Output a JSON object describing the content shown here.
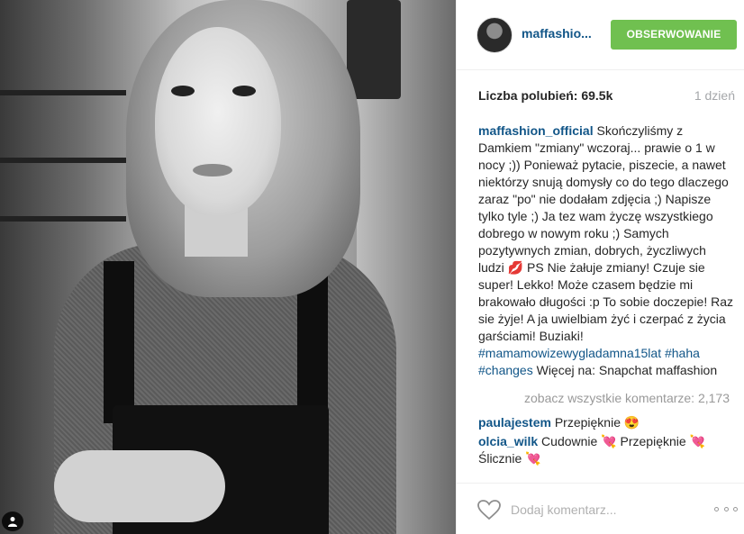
{
  "post": {
    "user_tag_icon": "person-icon"
  },
  "header": {
    "username": "maffashio...",
    "follow_label": "OBSERWOWANIE",
    "follow_color": "#70c050"
  },
  "stats": {
    "likes": "Liczba polubień: 69.5k",
    "age": "1 dzień"
  },
  "caption": {
    "author": "maffashion_official",
    "text_part1": " Skończyliśmy z Damkiem \"zmiany\" wczoraj... prawie o 1 w nocy ;)) Ponieważ pytacie, piszecie, a nawet niektórzy snują domysły co do tego dlaczego zaraz \"po\" nie dodałam zdjęcia ;) Napisze tylko tyle ;) Ja tez wam życzę wszystkiego dobrego w nowym roku ;) Samych pozytywnych zmian, dobrych, życzliwych ludzi 💋 PS Nie żałuje zmiany! Czuje sie super! Lekko! Może czasem będzie mi brakowało długości :p To sobie doczepie! Raz sie żyje! A ja uwielbiam żyć i czerpać z życia garściami! Buziaki!",
    "hashtags": "#mamamowizewygladamna15lat #haha #changes",
    "text_part2": " Więcej na: Snapchat maffashion"
  },
  "view_all": "zobacz wszystkie komentarze: 2,173",
  "comments": [
    {
      "author": "paulajestem",
      "text": " Przepięknie 😍"
    },
    {
      "author": "olcia_wilk",
      "text": " Cudownie 💘 Przepięknie 💘 Ślicznie 💘"
    }
  ],
  "footer": {
    "comment_placeholder": "Dodaj komentarz...",
    "like_icon": "heart-icon",
    "more_icon": "more-options-icon"
  }
}
